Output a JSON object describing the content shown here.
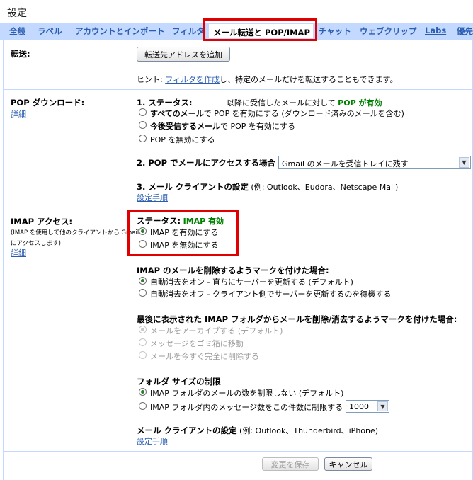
{
  "page_title": "設定",
  "tabs": [
    {
      "label": "全般"
    },
    {
      "label": "ラベル"
    },
    {
      "label": "アカウントとインポート"
    },
    {
      "label": "フィルタ"
    },
    {
      "label": "メール転送と POP/IMAP"
    },
    {
      "label": "チャット"
    },
    {
      "label": "ウェブクリップ"
    },
    {
      "label": "Labs"
    },
    {
      "label": "優先"
    }
  ],
  "forwarding": {
    "label": "転送:",
    "add_button": "転送先アドレスを追加",
    "hint_prefix": "ヒント: ",
    "hint_link": "フィルタを作成",
    "hint_suffix": "し、特定のメールだけを転送することもできます。"
  },
  "pop": {
    "label": "POP ダウンロード:",
    "details_link": "詳細",
    "status_heading": "1. ステータス:",
    "status_text": "以降に受信したメールに対して",
    "status_value": "POP が有効",
    "options": [
      {
        "bold": "すべてのメール",
        "rest": "で POP を有効にする (ダウンロード済みのメールを含む)"
      },
      {
        "bold": "今後受信するメール",
        "rest": "で POP を有効にする"
      },
      {
        "bold": "",
        "rest": "POP を無効にする"
      }
    ],
    "access_heading": "2. POP でメールにアクセスする場合",
    "access_selected": "Gmail のメールを受信トレイに残す",
    "client_heading": "3. メール クライアントの設定",
    "client_examples": "(例: Outlook、Eudora、Netscape Mail)",
    "client_link": "設定手順"
  },
  "imap": {
    "label": "IMAP アクセス:",
    "description_line1": "(IMAP を使用して他のクライアントから Gmail",
    "description_line2": "にアクセスします)",
    "details_link": "詳細",
    "status_heading": "ステータス:",
    "status_value": "IMAP 有効",
    "options": [
      "IMAP を有効にする",
      "IMAP を無効にする"
    ],
    "delete_heading": "IMAP のメールを削除するようマークを付けた場合:",
    "delete_options": [
      "自動消去をオン - 直ちにサーバーを更新する (デフォルト)",
      "自動消去をオフ - クライアント側でサーバーを更新するのを待機する"
    ],
    "expunge_heading": "最後に表示された IMAP フォルダからメールを削除/消去するようマークを付けた場合:",
    "expunge_options": [
      "メールをアーカイブする (デフォルト)",
      "メッセージをゴミ箱に移動",
      "メールを今すぐ完全に削除する"
    ],
    "folder_heading": "フォルダ サイズの制限",
    "folder_options": [
      "IMAP フォルダのメールの数を制限しない (デフォルト)",
      "IMAP フォルダ内のメッセージ数をこの件数に制限する"
    ],
    "folder_limit": "1000",
    "client_heading": "メール クライアントの設定",
    "client_examples": "(例: Outlook、Thunderbird、iPhone)",
    "client_link": "設定手順"
  },
  "footer": {
    "save_button": "変更を保存",
    "cancel_button": "キャンセル"
  },
  "colors": {
    "tab_bar": "#c3d9ff",
    "link": "#2a5db0",
    "status_green": "#008000",
    "highlight_red": "#e00000"
  }
}
